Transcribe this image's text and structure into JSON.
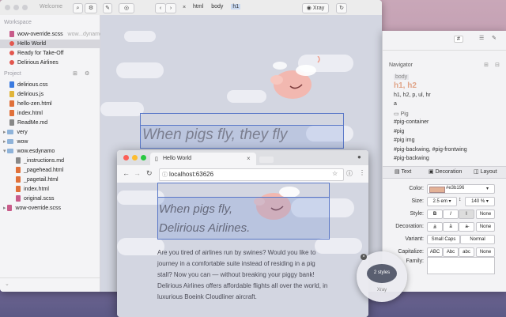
{
  "main": {
    "sidebar_title": "Welcome",
    "workspace_header": "Workspace",
    "workspace_items": [
      {
        "label": "wow-override.scss",
        "meta": "wow...dynamo"
      },
      {
        "label": "Hello World"
      },
      {
        "label": "Ready for Take-Off"
      },
      {
        "label": "Delirious Airlines"
      }
    ],
    "project_header": "Project",
    "project_items": [
      {
        "label": "delirious.css"
      },
      {
        "label": "delirious.js"
      },
      {
        "label": "hello-zen.html"
      },
      {
        "label": "index.html"
      },
      {
        "label": "ReadMe.md"
      },
      {
        "label": "very"
      },
      {
        "label": "wow"
      },
      {
        "label": "wow.esdynamo"
      },
      {
        "label": "_instructions.md"
      },
      {
        "label": "_pagehead.html"
      },
      {
        "label": "_pagetail.html"
      },
      {
        "label": "index.html"
      },
      {
        "label": "original.scss"
      },
      {
        "label": "wow-override.scss"
      }
    ],
    "breadcrumb": [
      "html",
      "body",
      "h1"
    ],
    "xray_label": "Xray",
    "headline": "When pigs fly, they fly"
  },
  "inspector": {
    "hash": "#",
    "navigator": "Navigator",
    "selectors": [
      "body",
      "h1, h2",
      "h1, h2, p, ul, hr",
      "a",
      "Pig",
      "#pig-container",
      "#pig",
      "#pig img",
      "#pig-backwing, #pig-frontwing",
      "#pig-backwing"
    ],
    "tabs": [
      "Text",
      "Decoration",
      "Layout"
    ],
    "color_label": "Color:",
    "color_value": "#e3b196",
    "size_label": "Size:",
    "size_value": "2.5 em",
    "line_value": "140 %",
    "style_label": "Style:",
    "style_none": "None",
    "decoration_label": "Decoration:",
    "variant_label": "Variant:",
    "variant_smallcaps": "Small Caps",
    "variant_normal": "Normal",
    "capitalize_label": "Capitalize:",
    "capitalize_options": [
      "ABC",
      "Abc",
      "abc",
      "None"
    ],
    "family_label": "Family:"
  },
  "browser": {
    "tab_title": "Hello World",
    "url": "localhost:63626",
    "headline_line1": "When pigs fly,",
    "headline_line2": "Delirious Airlines.",
    "paragraph": "Are you tired of airlines run by swines? Would you like to journey in a comfortable suite instead of residing in a pig stall? Now you can — without breaking your piggy bank! Delirious Airlines offers affordable flights all over the world, in luxurious Boeink Cloudliner aircraft."
  },
  "xray_popup": {
    "styles": "2 styles",
    "label": "Xray"
  },
  "colors": {
    "swatch": "#e3b196",
    "accent": "#5a78c8"
  }
}
